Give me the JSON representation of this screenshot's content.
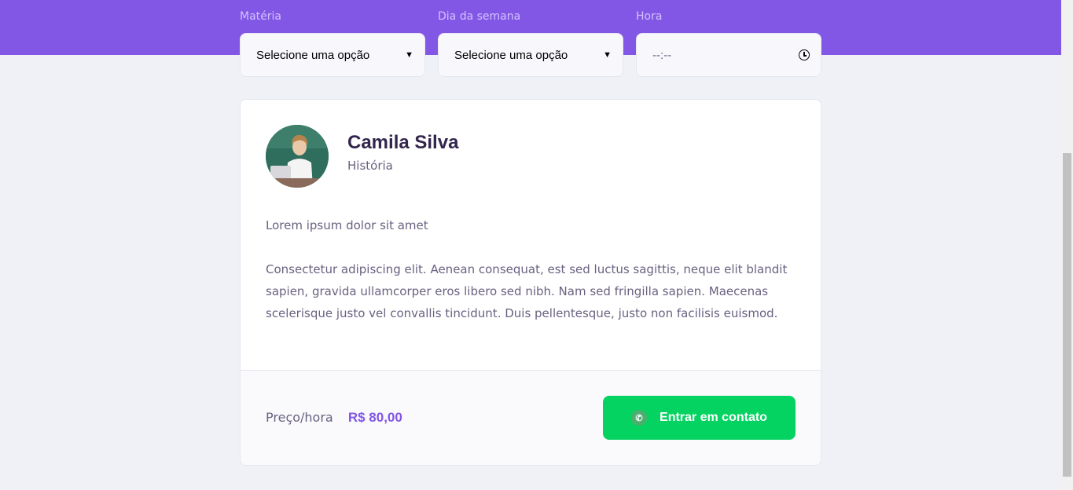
{
  "filters": {
    "subject": {
      "label": "Matéria",
      "value": "Selecione uma opção"
    },
    "weekday": {
      "label": "Dia da semana",
      "value": "Selecione uma opção"
    },
    "time": {
      "label": "Hora",
      "value": "--:--"
    }
  },
  "teacher": {
    "name": "Camila Silva",
    "subject": "História",
    "bio_intro": "Lorem ipsum dolor sit amet",
    "bio_body": "Consectetur adipiscing elit. Aenean consequat, est sed luctus sagittis, neque elit blandit sapien, gravida ullamcorper eros libero sed nibh. Nam sed fringilla sapien. Maecenas scelerisque justo vel convallis tincidunt. Duis pellentesque, justo non facilisis euismod.",
    "price_label": "Preço/hora",
    "price_value": "R$ 80,00",
    "contact_label": "Entrar em contato"
  },
  "icons": {
    "select_arrow": "chevron-down-icon",
    "time": "clock-icon",
    "contact": "whatsapp-icon"
  },
  "colors": {
    "primary": "#8257e5",
    "secondary": "#04d361",
    "text_title": "#32264d",
    "text_base": "#6a6180",
    "background": "#f0f0f7"
  }
}
